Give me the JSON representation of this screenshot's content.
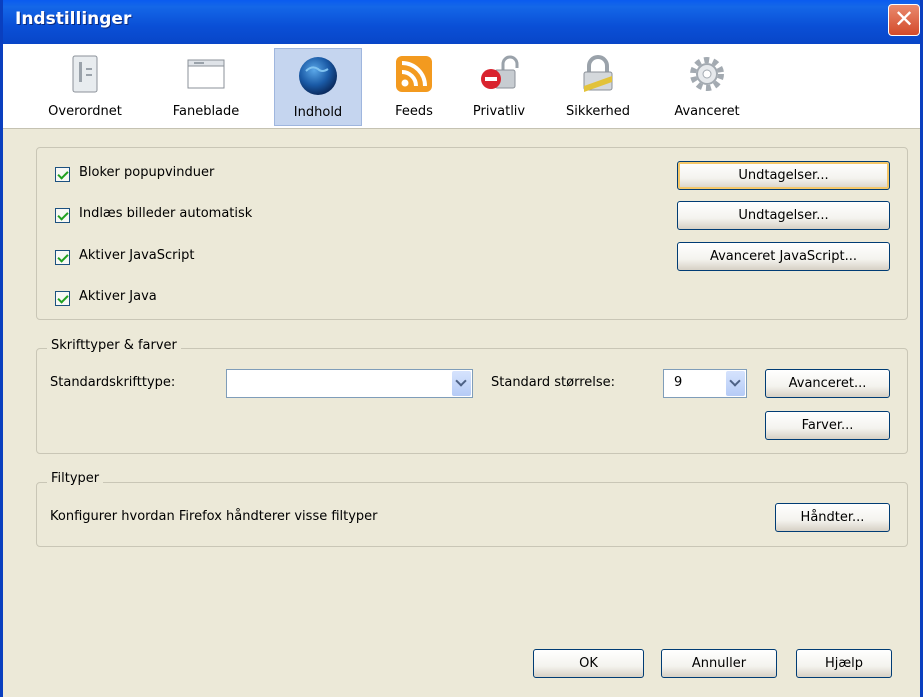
{
  "window": {
    "title": "Indstillinger",
    "close_glyph": "✕"
  },
  "toolbar": {
    "items": [
      {
        "label": "Overordnet",
        "icon": "general-icon"
      },
      {
        "label": "Faneblade",
        "icon": "tabs-icon"
      },
      {
        "label": "Indhold",
        "icon": "content-globe-icon",
        "selected": true
      },
      {
        "label": "Feeds",
        "icon": "feeds-icon"
      },
      {
        "label": "Privatliv",
        "icon": "privacy-icon"
      },
      {
        "label": "Sikkerhed",
        "icon": "security-lock-icon"
      },
      {
        "label": "Avanceret",
        "icon": "advanced-gear-icon"
      }
    ]
  },
  "content": {
    "checkboxes": [
      {
        "label": "Bloker popupvinduer",
        "checked": true
      },
      {
        "label": "Indlæs billeder automatisk",
        "checked": true
      },
      {
        "label": "Aktiver JavaScript",
        "checked": true
      },
      {
        "label": "Aktiver Java",
        "checked": true
      }
    ],
    "exceptions_popup": "Undtagelser...",
    "exceptions_images": "Undtagelser...",
    "advanced_js": "Avanceret JavaScript..."
  },
  "fonts": {
    "legend": "Skrifttyper & farver",
    "default_font_label": "Standardskrifttype:",
    "default_font_value": "",
    "size_label": "Standard størrelse:",
    "size_value": "9",
    "advanced": "Avanceret...",
    "colors": "Farver..."
  },
  "filetypes": {
    "legend": "Filtyper",
    "description": "Konfigurer hvordan Firefox håndterer visse filtyper",
    "manage": "Håndter..."
  },
  "footer": {
    "ok": "OK",
    "cancel": "Annuller",
    "help": "Hjælp"
  },
  "colors": {
    "titlebar": "#0a4fd6",
    "panel": "#ece9d8",
    "selected_tab": "#c5d5ef"
  }
}
